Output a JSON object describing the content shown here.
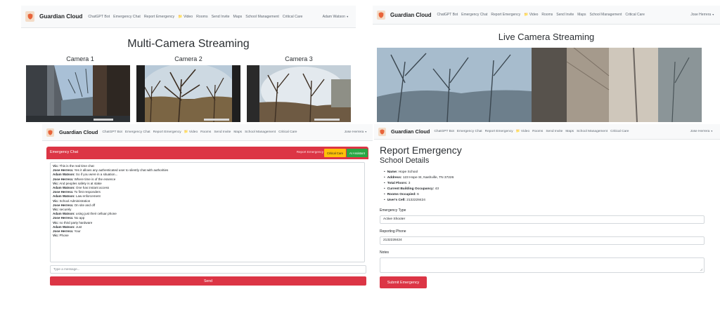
{
  "nav_common": {
    "brand": "Guardian Cloud",
    "links": [
      "ChatGPT Bot",
      "Emergency Chat",
      "Report Emergency",
      "📁 Video",
      "Rooms",
      "Send Invite",
      "Maps",
      "School Management",
      "Critical Care"
    ]
  },
  "multi_camera": {
    "user": "Adam Watson",
    "title": "Multi-Camera Streaming",
    "cameras": [
      "Camera 1",
      "Camera 2",
      "Camera 3"
    ]
  },
  "live_camera": {
    "user": "Jose Herrera",
    "title": "Live Camera Streaming"
  },
  "chat": {
    "user": "Jose Herrera",
    "header_title": "Emergency Chat",
    "report_link": "Report Emergency",
    "critical_care_button": "Critical Care",
    "ai_assistant_button": "AI Assistant",
    "messages": [
      {
        "sender": "Vic:",
        "text": " This is the real time chat"
      },
      {
        "sender": "Jose Herrera:",
        "text": " Yes it allows any authenticated user to silently chat with authorities"
      },
      {
        "sender": "Adam Watson:",
        "text": " So if you were in a situation..."
      },
      {
        "sender": "Jose Herrera:",
        "text": " Where time is of the essence"
      },
      {
        "sender": "Vic:",
        "text": " And peoples safety is at stake"
      },
      {
        "sender": "Adam Watson:",
        "text": " One has instant access"
      },
      {
        "sender": "Jose Herrera:",
        "text": " To first responders"
      },
      {
        "sender": "Adam Watson:",
        "text": " Law enforcement"
      },
      {
        "sender": "Vic:",
        "text": " School Administration"
      },
      {
        "sender": "Jose Herrera:",
        "text": " On site and off"
      },
      {
        "sender": "Vic:",
        "text": " securely"
      },
      {
        "sender": "Adam Watson:",
        "text": " using just their celluar phone"
      },
      {
        "sender": "Jose Herrera:",
        "text": " No app"
      },
      {
        "sender": "Vic:",
        "text": " no third party hardware"
      },
      {
        "sender": "Adam Watson:",
        "text": " Just"
      },
      {
        "sender": "Jose Herrera:",
        "text": " Your"
      },
      {
        "sender": "Vic:",
        "text": " Phone"
      }
    ],
    "input_placeholder": "Type a message...",
    "send_label": "Send"
  },
  "report": {
    "user": "Jose Herrera",
    "title": "Report Emergency",
    "subtitle": "School Details",
    "details": [
      {
        "label": "Name:",
        "value": " Hope School"
      },
      {
        "label": "Address:",
        "value": " 123 Hope St, Nashville, TN 37226"
      },
      {
        "label": "Total Floors:",
        "value": " 3"
      },
      {
        "label": "Current Building Occupancy:",
        "value": " 43"
      },
      {
        "label": "Rooms Occupied:",
        "value": " 6"
      },
      {
        "label": "User's Cell:",
        "value": " 2132228424"
      }
    ],
    "emergency_type_label": "Emergency Type",
    "emergency_type_value": "Active Shooter",
    "phone_label": "Reporting Phone",
    "phone_value": "2132228424",
    "notes_label": "Notes",
    "notes_value": "",
    "submit_label": "Submit Emergency"
  },
  "colors": {
    "danger": "#dc3545",
    "warning": "#ffc107",
    "success": "#28a745",
    "navbar": "#f8f9fa",
    "logo_bg": "#f3dcc8",
    "logo_shield": "#e8643a"
  }
}
